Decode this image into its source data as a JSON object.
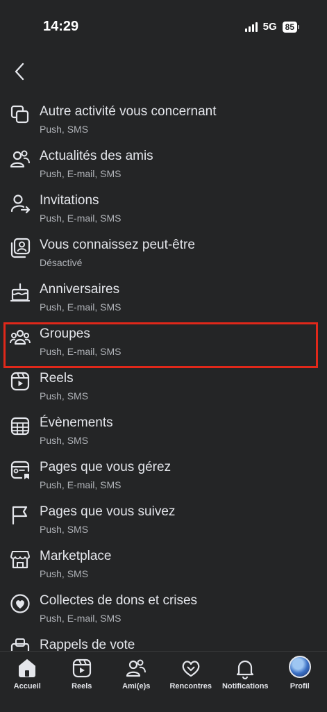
{
  "status": {
    "time": "14:29",
    "network": "5G",
    "battery": "85"
  },
  "items": [
    {
      "icon": "overlapping-squares-icon",
      "title": "Autre activité vous concernant",
      "sub": "Push, SMS"
    },
    {
      "icon": "friends-icon",
      "title": "Actualités des amis",
      "sub": "Push, E-mail, SMS"
    },
    {
      "icon": "invite-person-icon",
      "title": "Invitations",
      "sub": "Push, E-mail, SMS"
    },
    {
      "icon": "contact-card-icon",
      "title": "Vous connaissez peut-être",
      "sub": "Désactivé"
    },
    {
      "icon": "birthday-cake-icon",
      "title": "Anniversaires",
      "sub": "Push, E-mail, SMS"
    },
    {
      "icon": "groups-icon",
      "title": "Groupes",
      "sub": "Push, E-mail, SMS"
    },
    {
      "icon": "reels-icon",
      "title": "Reels",
      "sub": "Push, SMS"
    },
    {
      "icon": "calendar-icon",
      "title": "Évènements",
      "sub": "Push, SMS"
    },
    {
      "icon": "page-manage-icon",
      "title": "Pages que vous gérez",
      "sub": "Push, E-mail, SMS"
    },
    {
      "icon": "flag-icon",
      "title": "Pages que vous suivez",
      "sub": "Push, SMS"
    },
    {
      "icon": "marketplace-icon",
      "title": "Marketplace",
      "sub": "Push, SMS"
    },
    {
      "icon": "heart-coin-icon",
      "title": "Collectes de dons et crises",
      "sub": "Push, E-mail, SMS"
    },
    {
      "icon": "ballot-box-icon",
      "title": "Rappels de vote",
      "sub": ""
    }
  ],
  "tabs": [
    {
      "icon": "home-icon",
      "label": "Accueil"
    },
    {
      "icon": "reels-icon",
      "label": "Reels"
    },
    {
      "icon": "friends-icon",
      "label": "Ami(e)s"
    },
    {
      "icon": "dating-heart-icon",
      "label": "Rencontres"
    },
    {
      "icon": "bell-icon",
      "label": "Notifications"
    },
    {
      "icon": "profile-avatar",
      "label": "Profil"
    }
  ],
  "colors": {
    "background": "#242526",
    "highlight": "#e0281a",
    "text": "#e4e6eb",
    "subtext": "#b0b3b8"
  }
}
